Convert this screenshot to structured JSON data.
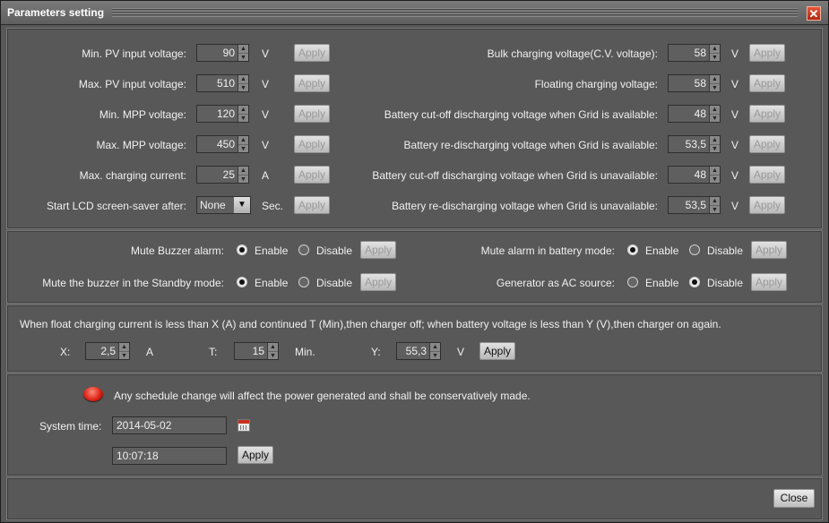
{
  "window": {
    "title": "Parameters setting",
    "close_glyph": "✕"
  },
  "common": {
    "apply": "Apply",
    "enable": "Enable",
    "disable": "Disable",
    "spin_up": "▲",
    "spin_down": "▼",
    "dropdown_arrow": "▼"
  },
  "left_params": [
    {
      "label": "Min. PV input voltage:",
      "value": "90",
      "unit": "V"
    },
    {
      "label": "Max. PV input voltage:",
      "value": "510",
      "unit": "V"
    },
    {
      "label": "Min. MPP voltage:",
      "value": "120",
      "unit": "V"
    },
    {
      "label": "Max. MPP voltage:",
      "value": "450",
      "unit": "V"
    },
    {
      "label": "Max. charging current:",
      "value": "25",
      "unit": "A"
    }
  ],
  "screensaver": {
    "label": "Start LCD screen-saver after:",
    "value": "None",
    "unit": "Sec."
  },
  "right_params": [
    {
      "label": "Bulk charging voltage(C.V. voltage):",
      "value": "58",
      "unit": "V"
    },
    {
      "label": "Floating charging voltage:",
      "value": "58",
      "unit": "V"
    },
    {
      "label": "Battery cut-off discharging voltage when Grid is available:",
      "value": "48",
      "unit": "V"
    },
    {
      "label": "Battery re-discharging voltage when Grid is available:",
      "value": "53,5",
      "unit": "V"
    },
    {
      "label": "Battery cut-off discharging voltage when Grid is unavailable:",
      "value": "48",
      "unit": "V"
    },
    {
      "label": "Battery re-discharging voltage when Grid is unavailable:",
      "value": "53,5",
      "unit": "V"
    }
  ],
  "toggles": [
    {
      "label": "Mute Buzzer alarm:",
      "selected": "Enable"
    },
    {
      "label": "Mute the buzzer in the Standby mode:",
      "selected": "Enable"
    },
    {
      "label": "Mute alarm in battery mode:",
      "selected": "Enable"
    },
    {
      "label": "Generator as AC source:",
      "selected": "Disable"
    }
  ],
  "float_charge": {
    "description": "When float charging current is less than X (A) and continued T (Min),then charger off; when battery voltage is less than Y (V),then charger on again.",
    "x": {
      "label": "X:",
      "value": "2,5",
      "unit": "A"
    },
    "t": {
      "label": "T:",
      "value": "15",
      "unit": "Min."
    },
    "y": {
      "label": "Y:",
      "value": "55,3",
      "unit": "V"
    }
  },
  "schedule": {
    "warning": "Any schedule change will affect the power generated and shall be conservatively made.",
    "system_time_label": "System time:",
    "date": "2014-05-02",
    "time": "10:07:18"
  },
  "footer": {
    "close_label": "Close"
  },
  "colors": {
    "background": "#585858",
    "warning_icon": "#d81e10"
  }
}
